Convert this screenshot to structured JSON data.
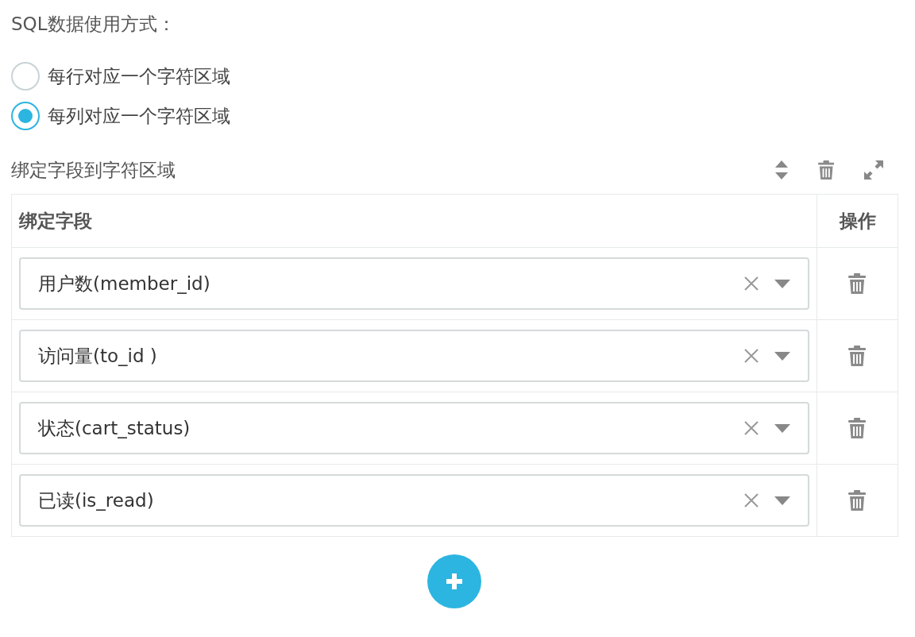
{
  "usage": {
    "label": "SQL数据使用方式：",
    "options": [
      {
        "label": "每行对应一个字符区域",
        "selected": false
      },
      {
        "label": "每列对应一个字符区域",
        "selected": true
      }
    ]
  },
  "binding": {
    "title": "绑定字段到字符区域",
    "table": {
      "columns": [
        "绑定字段",
        "操作"
      ],
      "rows": [
        {
          "value": "用户数(member_id)"
        },
        {
          "value": "访问量(to_id )"
        },
        {
          "value": "状态(cart_status)"
        },
        {
          "value": "已读(is_read)"
        }
      ]
    }
  }
}
